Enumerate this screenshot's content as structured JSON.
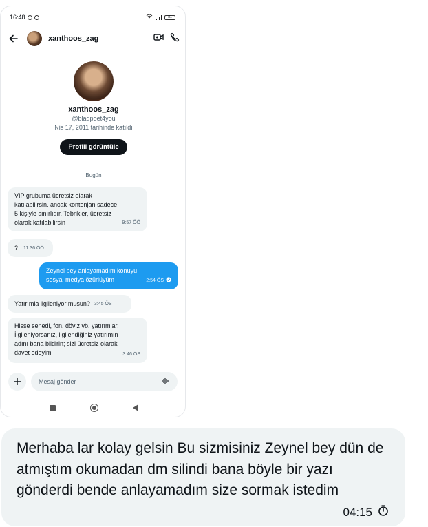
{
  "phone": {
    "status": {
      "time": "16:48",
      "battery": "81"
    },
    "header": {
      "name": "xanthoos_zag"
    },
    "profile": {
      "name": "xanthoos_zag",
      "handle": "@blaqpoet4you",
      "joined": "Nis 17, 2011 tarihinde katıldı",
      "view_button": "Profili görüntüle"
    },
    "date_separator": "Bugün",
    "messages": [
      {
        "direction": "in",
        "text": "VIP grubuma ücretsiz olarak\nkatılabilirsin. ancak kontenjan sadece\n5 kişiyle sınırlıdır. Tebrikler, ücretsiz\nolarak katılabilirsin",
        "time": "9:57 ÖÖ"
      },
      {
        "direction": "in",
        "text": "?",
        "time": "11:36 ÖÖ"
      },
      {
        "direction": "out",
        "text": "Zeynel bey anlayamadım  konuyu\nsosyal medya özürlüyüm",
        "time": "2:54 ÖS"
      },
      {
        "direction": "in",
        "text": "Yatırımla ilgileniyor musun?",
        "time": "3:45 ÖS"
      },
      {
        "direction": "in",
        "text": "Hisse senedi, fon, döviz vb. yatırımlar.\nİlgileniyorsanız, ilgilendiğiniz yatırımın\nadını bana bildirin; sizi ücretsiz olarak\ndavet edeyim",
        "time": "3:46 ÖS"
      }
    ],
    "composer": {
      "placeholder": "Mesaj gönder"
    }
  },
  "chat_message": {
    "text": "Merhaba lar kolay gelsin Bu sizmisiniz Zeynel bey dün de atmıştım okumadan dm silindi bana böyle bir yazı gönderdi bende anlayamadım size sormak istedim",
    "time": "04:15"
  },
  "colors": {
    "accent": "#1d9bf0",
    "incoming_bubble": "#eff3f4",
    "primary_text": "#0f1419",
    "secondary_text": "#536471",
    "button_bg": "#0f1419"
  },
  "icons": [
    "back-arrow-icon",
    "video-call-icon",
    "phone-call-icon",
    "plus-icon",
    "voice-wave-icon",
    "read-check-icon",
    "timer-icon"
  ]
}
